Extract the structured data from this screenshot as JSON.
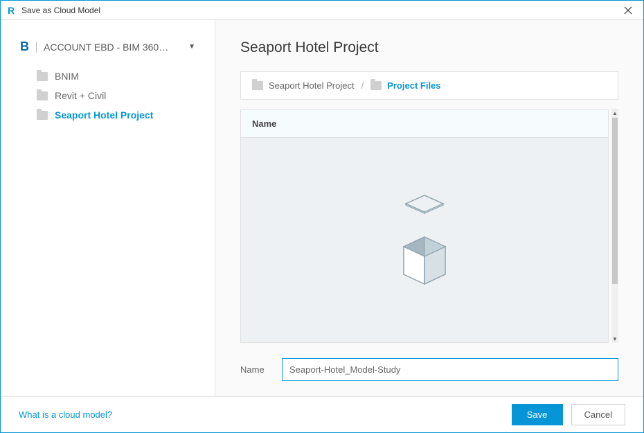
{
  "window": {
    "title": "Save as Cloud Model"
  },
  "sidebar": {
    "account_label": "ACCOUNT EBD - BIM 360…",
    "items": [
      {
        "label": "BNIM",
        "active": false
      },
      {
        "label": "Revit + Civil",
        "active": false
      },
      {
        "label": "Seaport Hotel Project",
        "active": true
      }
    ]
  },
  "main": {
    "heading": "Seaport Hotel Project",
    "breadcrumb": [
      {
        "label": "Seaport Hotel Project",
        "active": false
      },
      {
        "label": "Project Files",
        "active": true
      }
    ],
    "list": {
      "column_header": "Name"
    },
    "name_field": {
      "label": "Name",
      "value": "Seaport-Hotel_Model-Study"
    }
  },
  "footer": {
    "help_link": "What is a cloud model?",
    "save_label": "Save",
    "cancel_label": "Cancel"
  }
}
